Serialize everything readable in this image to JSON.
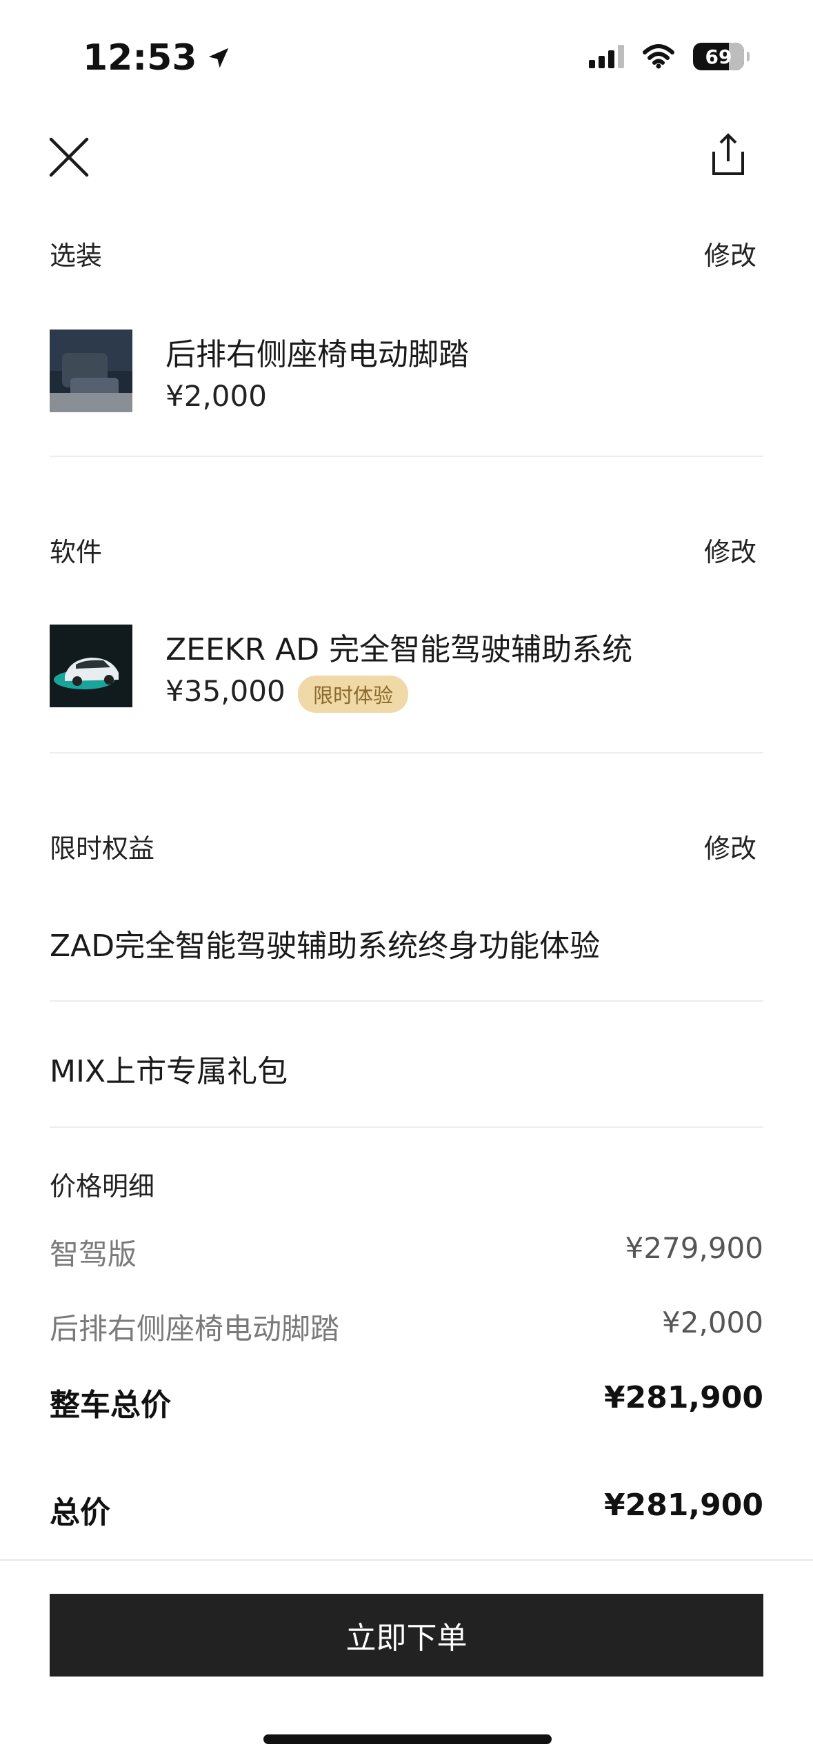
{
  "status_bar": {
    "time": "12:53",
    "battery": "69"
  },
  "nav": {
    "close_icon": "close-icon",
    "share_icon": "share-icon"
  },
  "options": {
    "title": "选装",
    "modify_label": "修改",
    "item_name": "后排右侧座椅电动脚踏",
    "item_price": "¥2,000"
  },
  "software": {
    "title": "软件",
    "modify_label": "修改",
    "item_name": "ZEEKR AD 完全智能驾驶辅助系统",
    "item_price": "¥35,000",
    "badge": "限时体验"
  },
  "benefits": {
    "title": "限时权益",
    "modify_label": "修改",
    "items": [
      "ZAD完全智能驾驶辅助系统终身功能体验",
      "MIX上市专属礼包"
    ]
  },
  "price_details": {
    "title": "价格明细",
    "rows": [
      {
        "label": "智驾版",
        "value": "¥279,900"
      },
      {
        "label": "后排右侧座椅电动脚踏",
        "value": "¥2,000"
      }
    ],
    "vehicle_total_label": "整车总价",
    "vehicle_total_value": "¥281,900",
    "total_label": "总价",
    "total_value": "¥281,900"
  },
  "order_button": "立即下单",
  "colors": {
    "button_bg": "#222222",
    "badge_bg": "#f0d9a6",
    "badge_text": "#8a6a2b"
  }
}
